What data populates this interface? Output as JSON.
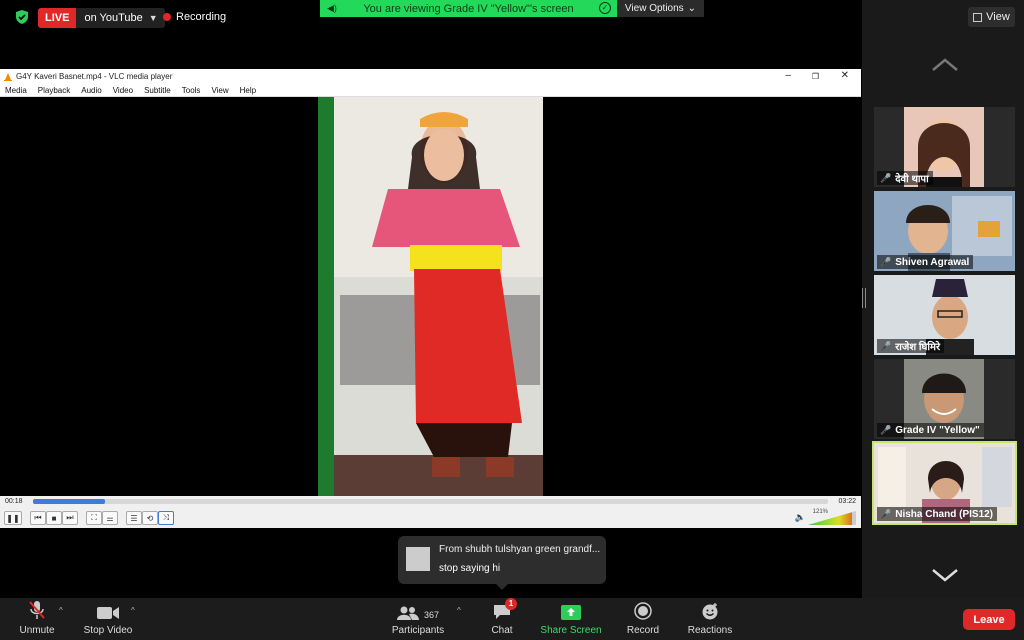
{
  "topbar": {
    "live_label": "LIVE",
    "youtube_label": "on YouTube",
    "recording_label": "Recording",
    "share_banner": "You are viewing Grade IV \"Yellow\"'s screen",
    "view_options": "View Options"
  },
  "vlc": {
    "title": "G4Y Kaveri Basnet.mp4 - VLC media player",
    "menu": [
      "Media",
      "Playback",
      "Audio",
      "Video",
      "Subtitle",
      "Tools",
      "View",
      "Help"
    ],
    "elapsed": "00:18",
    "duration": "03:22",
    "progress_fraction": 0.09,
    "volume_label": "121%"
  },
  "panel": {
    "view_label": "View",
    "participants": [
      {
        "name": "देवी थापा"
      },
      {
        "name": "Shiven Agrawal"
      },
      {
        "name": "राजेश घिमिरे"
      },
      {
        "name": "Grade IV \"Yellow\""
      },
      {
        "name": "Nisha Chand (PIS12)"
      }
    ]
  },
  "chat_popup": {
    "from": "From shubh tulshyan green grandf...",
    "message": "stop saying hi"
  },
  "toolbar": {
    "unmute": "Unmute",
    "stop_video": "Stop Video",
    "participants_count": "367",
    "participants": "Participants",
    "chat": "Chat",
    "chat_badge": "1",
    "share_screen": "Share Screen",
    "record": "Record",
    "reactions": "Reactions",
    "leave": "Leave"
  },
  "colors": {
    "live_red": "#e02828",
    "share_green": "#23d959",
    "active_tile": "#c5e86c"
  }
}
